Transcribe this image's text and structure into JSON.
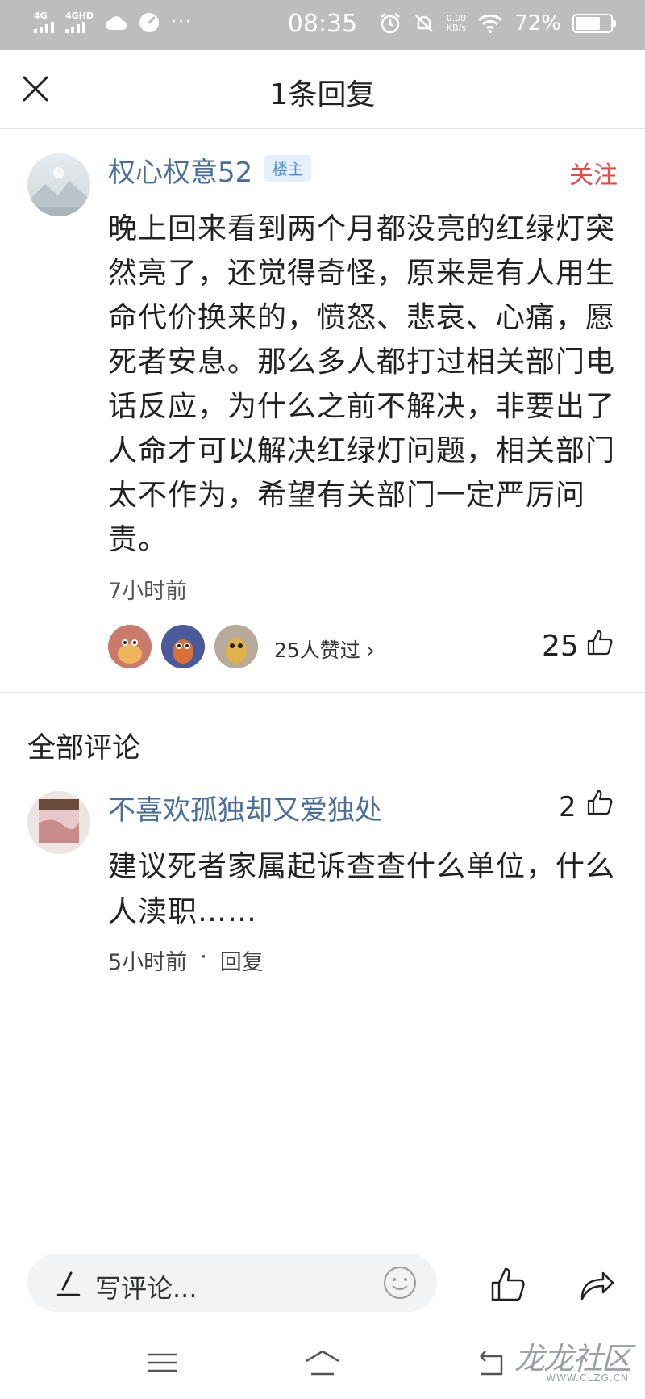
{
  "status_bar": {
    "net1": "4G",
    "net2": "4GHD",
    "time": "08:35",
    "speed_value": "0.00",
    "speed_unit": "KB/s",
    "battery_text": "72%",
    "battery_level": 0.72
  },
  "header": {
    "title": "1条回复",
    "close_icon": "close-icon"
  },
  "post": {
    "author": "权心权意52",
    "badge": "楼主",
    "follow_label": "关注",
    "text": "晚上回来看到两个月都没亮的红绿灯突然亮了，还觉得奇怪，原来是有人用生命代价换来的，愤怒、悲哀、心痛，愿死者安息。那么多人都打过相关部门电话反应，为什么之前不解决，非要出了人命才可以解决红绿灯问题，相关部门太不作为，希望有关部门一定严厉问责。",
    "time": "7小时前",
    "likers_text": "25人赞过 ›",
    "like_count": "25"
  },
  "comments_section": {
    "title": "全部评论",
    "items": [
      {
        "author": "不喜欢孤独却又爱独处",
        "like_count": "2",
        "text": "建议死者家属起诉查查什么单位，什么人渎职……",
        "time": "5小时前",
        "separator": "·",
        "reply_label": "回复"
      }
    ]
  },
  "bottom_bar": {
    "input_placeholder": "写评论..."
  },
  "watermark": {
    "cn": "龙龙社区",
    "en": "WWW.CLZG.CN"
  },
  "colors": {
    "author_blue": "#4a6e9a",
    "follow_red": "#e84a4a",
    "badge_blue": "#4a8ad6",
    "status_bar_bg": "#bdbdbd"
  }
}
